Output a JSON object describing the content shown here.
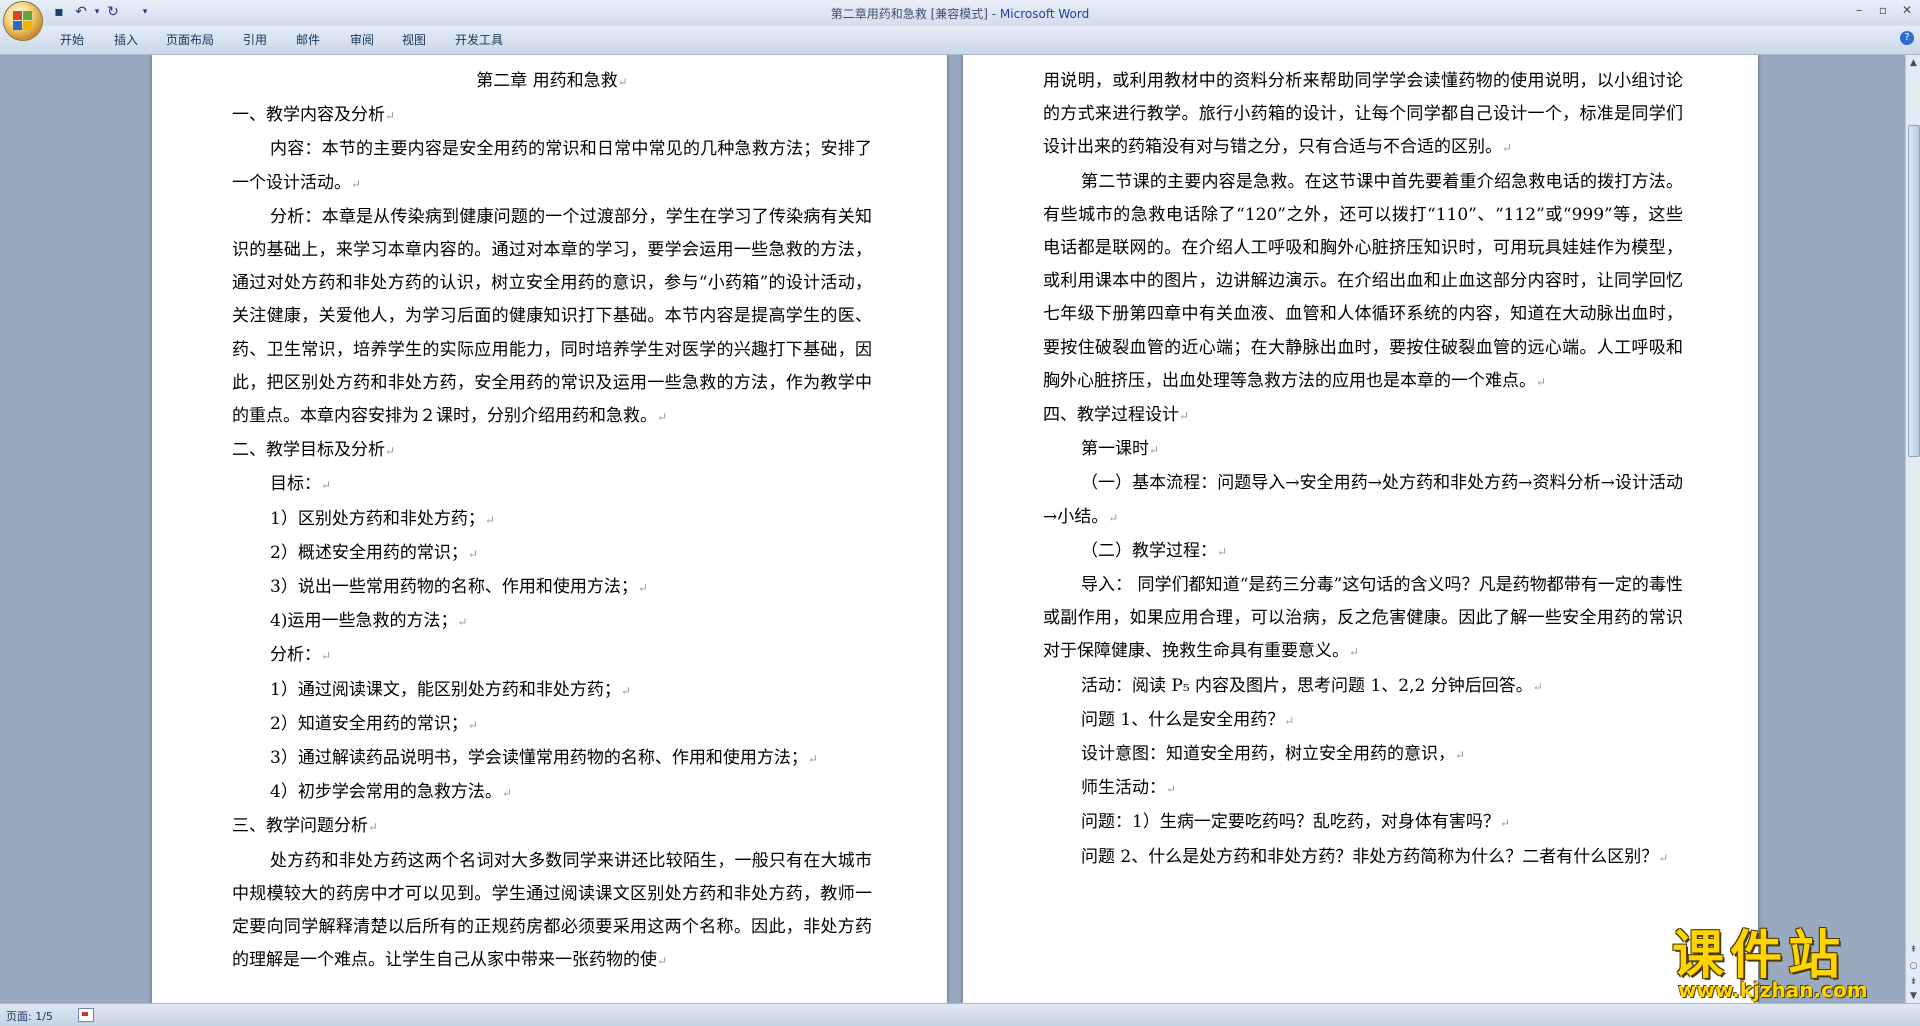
{
  "window": {
    "title_doc": "第二章用药和急救 [兼容模式] - ",
    "title_app": "Microsoft Word"
  },
  "ribbon_tabs": [
    "开始",
    "插入",
    "页面布局",
    "引用",
    "邮件",
    "审阅",
    "视图",
    "开发工具"
  ],
  "page1": {
    "heading": "第二章  用药和急救",
    "paragraphs": [
      {
        "style": "h",
        "text": "一、教学内容及分析"
      },
      {
        "style": "i2",
        "text": "内容：本节的主要内容是安全用药的常识和日常中常见的几种急救方法；安排了一个设计活动。"
      },
      {
        "style": "i2",
        "text": "分析：本章是从传染病到健康问题的一个过渡部分，学生在学习了传染病有关知识的基础上，来学习本章内容的。通过对本章的学习，要学会运用一些急救的方法，通过对处方药和非处方药的认识，树立安全用药的意识，参与“小药箱”的设计活动，关注健康，关爱他人，为学习后面的健康知识打下基础。本节内容是提高学生的医、药、卫生常识，培养学生的实际应用能力，同时培养学生对医学的兴趣打下基础，因此，把区别处方药和非处方药，安全用药的常识及运用一些急救的方法，作为教学中的重点。本章内容安排为２课时，分别介绍用药和急救。"
      },
      {
        "style": "h",
        "text": "二、教学目标及分析"
      },
      {
        "style": "l1",
        "text": "目标："
      },
      {
        "style": "l1",
        "text": "1）区别处方药和非处方药；"
      },
      {
        "style": "l1",
        "text": "2）概述安全用药的常识；"
      },
      {
        "style": "l1",
        "text": "3）说出一些常用药物的名称、作用和使用方法；"
      },
      {
        "style": "l1",
        "text": "4)运用一些急救的方法；"
      },
      {
        "style": "l1",
        "text": "分析："
      },
      {
        "style": "l1",
        "text": "1）通过阅读课文，能区别处方药和非处方药；"
      },
      {
        "style": "l1",
        "text": "2）知道安全用药的常识；"
      },
      {
        "style": "l1",
        "text": "3）通过解读药品说明书，学会读懂常用药物的名称、作用和使用方法；"
      },
      {
        "style": "l1",
        "text": "4）初步学会常用的急救方法。"
      },
      {
        "style": "h",
        "text": "三、教学问题分析"
      },
      {
        "style": "i2",
        "text": "处方药和非处方药这两个名词对大多数同学来讲还比较陌生，一般只有在大城市中规模较大的药房中才可以见到。学生通过阅读课文区别处方药和非处方药，教师一定要向同学解释清楚以后所有的正规药房都必须要采用这两个名称。因此，非处方药的理解是一个难点。让学生自己从家中带来一张药物的使"
      }
    ]
  },
  "page2": {
    "paragraphs": [
      {
        "style": "h",
        "text": "用说明，或利用教材中的资料分析来帮助同学学会读懂药物的使用说明，以小组讨论的方式来进行教学。旅行小药箱的设计，让每个同学都自己设计一个，标准是同学们设计出来的药箱没有对与错之分，只有合适与不合适的区别。"
      },
      {
        "style": "i2",
        "text": "第二节课的主要内容是急救。在这节课中首先要着重介绍急救电话的拨打方法。有些城市的急救电话除了“120”之外，还可以拨打“110”、“112”或“999”等，这些电话都是联网的。在介绍人工呼吸和胸外心脏挤压知识时，可用玩具娃娃作为模型，或利用课本中的图片，边讲解边演示。在介绍出血和止血这部分内容时，让同学回忆七年级下册第四章中有关血液、血管和人体循环系统的内容，知道在大动脉出血时，要按住破裂血管的近心端；在大静脉出血时，要按住破裂血管的远心端。人工呼吸和胸外心脏挤压，出血处理等急救方法的应用也是本章的一个难点。"
      },
      {
        "style": "h",
        "text": "四、教学过程设计"
      },
      {
        "style": "l1",
        "text": "第一课时"
      },
      {
        "style": "i2",
        "text": "（一）基本流程：问题导入→安全用药→处方药和非处方药→资料分析→设计活动→小结。"
      },
      {
        "style": "l1",
        "text": "（二）教学过程："
      },
      {
        "style": "i2",
        "text": "导入：  同学们都知道“是药三分毒”这句话的含义吗？凡是药物都带有一定的毒性或副作用，如果应用合理，可以治病，反之危害健康。因此了解一些安全用药的常识对于保障健康、挽救生命具有重要意义。"
      },
      {
        "style": "l1",
        "text": "活动：阅读 P₅ 内容及图片，思考问题 1、2,2 分钟后回答。"
      },
      {
        "style": "l1",
        "text": "问题 1、什么是安全用药？"
      },
      {
        "style": "l1",
        "text": "设计意图：知道安全用药，树立安全用药的意识，"
      },
      {
        "style": "l1",
        "text": "师生活动："
      },
      {
        "style": "l1",
        "text": "问题：1）生病一定要吃药吗？乱吃药，对身体有害吗？"
      },
      {
        "style": "i2",
        "text": "问题 2、什么是处方药和非处方药？非处方药简称为什么？二者有什么区别？"
      }
    ]
  },
  "paragraph_mark": "↵",
  "status": {
    "page": "页面: 1/5"
  },
  "watermark": {
    "main": "课件站",
    "url": "www.kjzhan.com"
  }
}
